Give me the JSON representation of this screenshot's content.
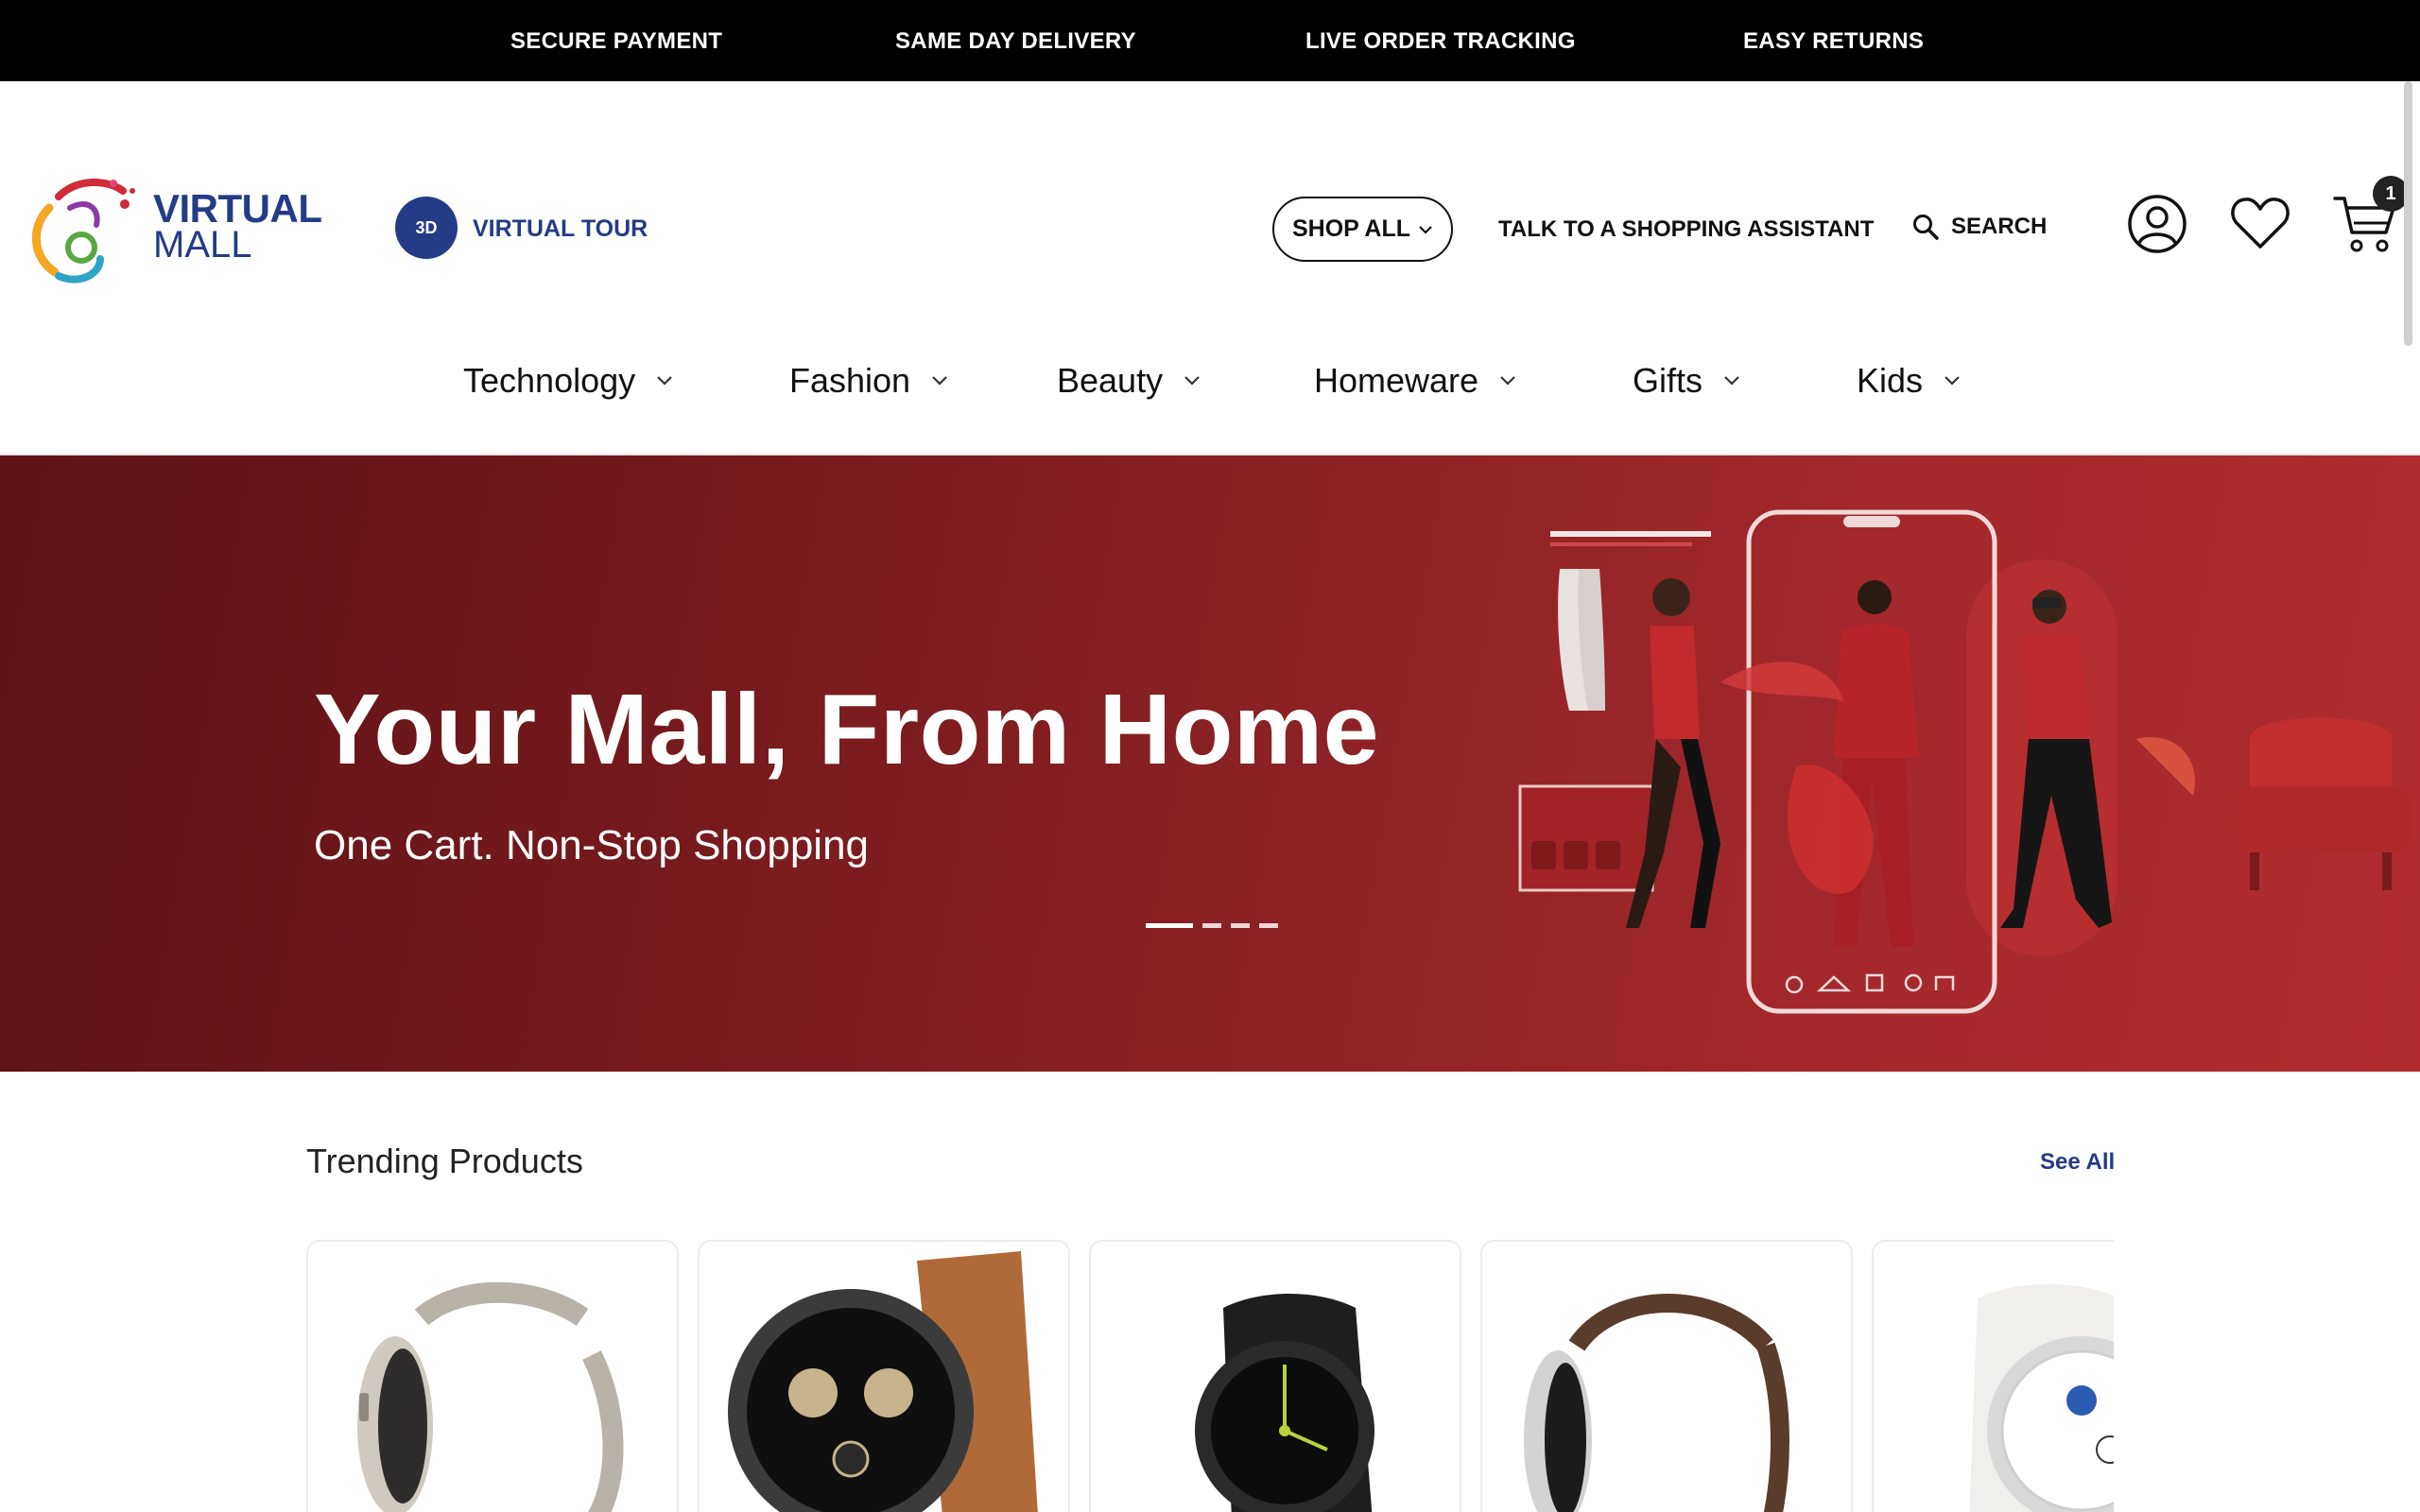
{
  "top_strip": {
    "items": [
      "SECURE PAYMENT",
      "SAME DAY DELIVERY",
      "LIVE ORDER TRACKING",
      "EASY RETURNS"
    ]
  },
  "header": {
    "logo": {
      "line1": "VIRTUAL",
      "line2": "MALL"
    },
    "virtual_tour": {
      "badge": "3D",
      "label": "VIRTUAL TOUR"
    },
    "shop_all_label": "SHOP ALL",
    "assistant_label": "TALK TO A SHOPPING ASSISTANT",
    "search_label": "SEARCH",
    "cart_count": "1",
    "icons": [
      "account-icon",
      "heart-icon",
      "cart-icon",
      "search-icon",
      "chevron-down-icon"
    ]
  },
  "categories": [
    "Technology",
    "Fashion",
    "Beauty",
    "Homeware",
    "Gifts",
    "Kids"
  ],
  "hero": {
    "title": "Your Mall, From Home",
    "subtitle": "One Cart. Non-Stop Shopping",
    "slides_total": 4,
    "active_slide": 1
  },
  "trending": {
    "title": "Trending Products",
    "see_all": "See All",
    "products": [
      "watch-titanium-bracelet",
      "watch-leather-black-dial",
      "watch-black-sport",
      "watch-brown-leather",
      "watch-white-leather"
    ]
  },
  "colors": {
    "brand": "#243b86",
    "hero_red": "#8d2226",
    "top_strip": "#000000"
  }
}
